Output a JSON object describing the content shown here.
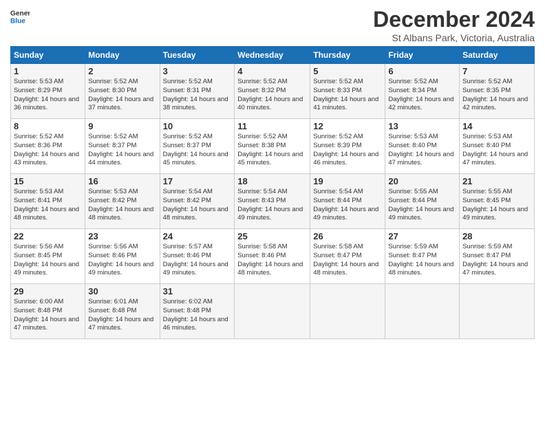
{
  "header": {
    "logo_general": "General",
    "logo_blue": "Blue",
    "title": "December 2024",
    "subtitle": "St Albans Park, Victoria, Australia"
  },
  "calendar": {
    "days_of_week": [
      "Sunday",
      "Monday",
      "Tuesday",
      "Wednesday",
      "Thursday",
      "Friday",
      "Saturday"
    ],
    "weeks": [
      [
        null,
        {
          "day": 2,
          "sunrise": "5:52 AM",
          "sunset": "8:30 PM",
          "daylight": "14 hours and 37 minutes."
        },
        {
          "day": 3,
          "sunrise": "5:52 AM",
          "sunset": "8:31 PM",
          "daylight": "14 hours and 38 minutes."
        },
        {
          "day": 4,
          "sunrise": "5:52 AM",
          "sunset": "8:32 PM",
          "daylight": "14 hours and 40 minutes."
        },
        {
          "day": 5,
          "sunrise": "5:52 AM",
          "sunset": "8:33 PM",
          "daylight": "14 hours and 41 minutes."
        },
        {
          "day": 6,
          "sunrise": "5:52 AM",
          "sunset": "8:34 PM",
          "daylight": "14 hours and 42 minutes."
        },
        {
          "day": 7,
          "sunrise": "5:52 AM",
          "sunset": "8:35 PM",
          "daylight": "14 hours and 42 minutes."
        }
      ],
      [
        {
          "day": 1,
          "sunrise": "5:53 AM",
          "sunset": "8:29 PM",
          "daylight": "14 hours and 36 minutes."
        },
        {
          "day": 8,
          "sunrise": null,
          "sunset": null,
          "daylight": null
        },
        null,
        null,
        null,
        null,
        null
      ],
      [
        {
          "day": 8,
          "sunrise": "5:52 AM",
          "sunset": "8:36 PM",
          "daylight": "14 hours and 43 minutes."
        },
        {
          "day": 9,
          "sunrise": "5:52 AM",
          "sunset": "8:37 PM",
          "daylight": "14 hours and 44 minutes."
        },
        {
          "day": 10,
          "sunrise": "5:52 AM",
          "sunset": "8:37 PM",
          "daylight": "14 hours and 45 minutes."
        },
        {
          "day": 11,
          "sunrise": "5:52 AM",
          "sunset": "8:38 PM",
          "daylight": "14 hours and 45 minutes."
        },
        {
          "day": 12,
          "sunrise": "5:52 AM",
          "sunset": "8:39 PM",
          "daylight": "14 hours and 46 minutes."
        },
        {
          "day": 13,
          "sunrise": "5:53 AM",
          "sunset": "8:40 PM",
          "daylight": "14 hours and 47 minutes."
        },
        {
          "day": 14,
          "sunrise": "5:53 AM",
          "sunset": "8:40 PM",
          "daylight": "14 hours and 47 minutes."
        }
      ],
      [
        {
          "day": 15,
          "sunrise": "5:53 AM",
          "sunset": "8:41 PM",
          "daylight": "14 hours and 48 minutes."
        },
        {
          "day": 16,
          "sunrise": "5:53 AM",
          "sunset": "8:42 PM",
          "daylight": "14 hours and 48 minutes."
        },
        {
          "day": 17,
          "sunrise": "5:54 AM",
          "sunset": "8:42 PM",
          "daylight": "14 hours and 48 minutes."
        },
        {
          "day": 18,
          "sunrise": "5:54 AM",
          "sunset": "8:43 PM",
          "daylight": "14 hours and 49 minutes."
        },
        {
          "day": 19,
          "sunrise": "5:54 AM",
          "sunset": "8:44 PM",
          "daylight": "14 hours and 49 minutes."
        },
        {
          "day": 20,
          "sunrise": "5:55 AM",
          "sunset": "8:44 PM",
          "daylight": "14 hours and 49 minutes."
        },
        {
          "day": 21,
          "sunrise": "5:55 AM",
          "sunset": "8:45 PM",
          "daylight": "14 hours and 49 minutes."
        }
      ],
      [
        {
          "day": 22,
          "sunrise": "5:56 AM",
          "sunset": "8:45 PM",
          "daylight": "14 hours and 49 minutes."
        },
        {
          "day": 23,
          "sunrise": "5:56 AM",
          "sunset": "8:46 PM",
          "daylight": "14 hours and 49 minutes."
        },
        {
          "day": 24,
          "sunrise": "5:57 AM",
          "sunset": "8:46 PM",
          "daylight": "14 hours and 49 minutes."
        },
        {
          "day": 25,
          "sunrise": "5:58 AM",
          "sunset": "8:46 PM",
          "daylight": "14 hours and 48 minutes."
        },
        {
          "day": 26,
          "sunrise": "5:58 AM",
          "sunset": "8:47 PM",
          "daylight": "14 hours and 48 minutes."
        },
        {
          "day": 27,
          "sunrise": "5:59 AM",
          "sunset": "8:47 PM",
          "daylight": "14 hours and 48 minutes."
        },
        {
          "day": 28,
          "sunrise": "5:59 AM",
          "sunset": "8:47 PM",
          "daylight": "14 hours and 47 minutes."
        }
      ],
      [
        {
          "day": 29,
          "sunrise": "6:00 AM",
          "sunset": "8:48 PM",
          "daylight": "14 hours and 47 minutes."
        },
        {
          "day": 30,
          "sunrise": "6:01 AM",
          "sunset": "8:48 PM",
          "daylight": "14 hours and 47 minutes."
        },
        {
          "day": 31,
          "sunrise": "6:02 AM",
          "sunset": "8:48 PM",
          "daylight": "14 hours and 46 minutes."
        },
        null,
        null,
        null,
        null
      ]
    ]
  }
}
